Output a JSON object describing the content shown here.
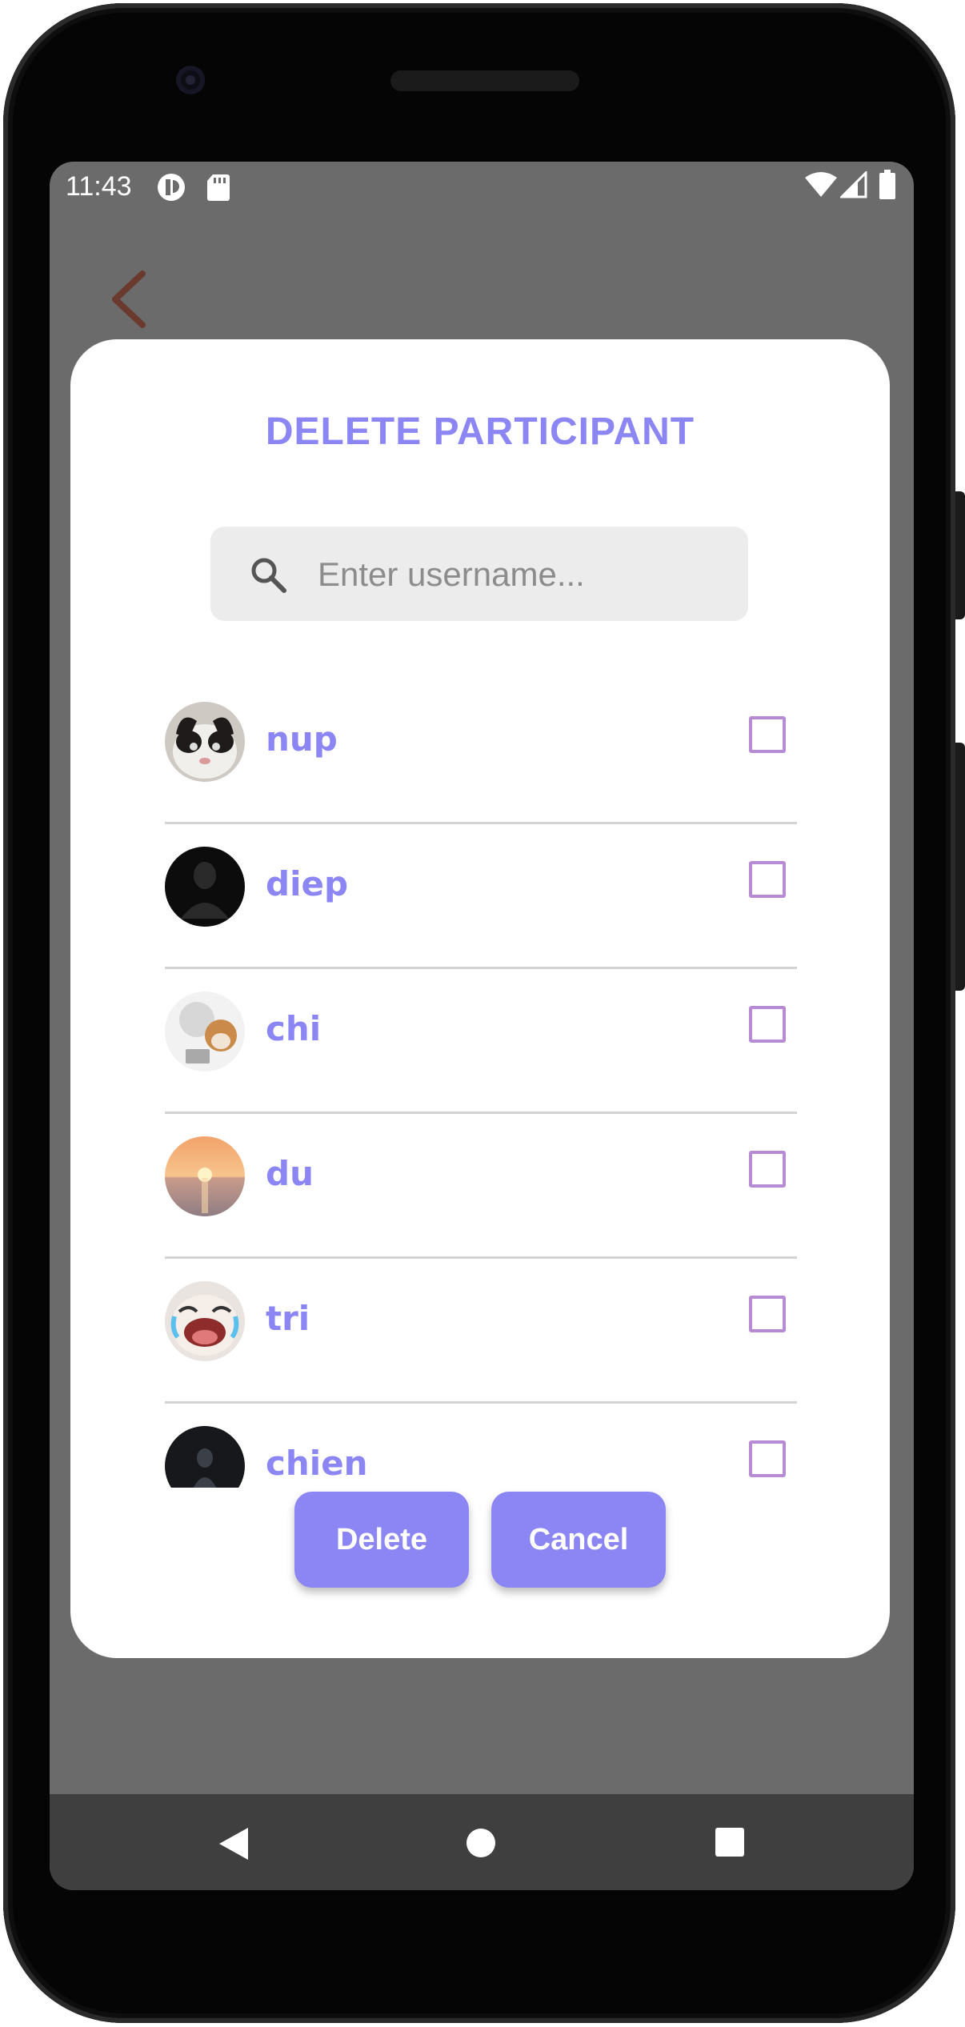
{
  "status_bar": {
    "time": "11:43"
  },
  "dialog": {
    "title": "DELETE PARTICIPANT",
    "search": {
      "placeholder": "Enter username...",
      "value": ""
    },
    "participants": [
      {
        "name": "nup",
        "checked": false
      },
      {
        "name": "diep",
        "checked": false
      },
      {
        "name": "chi",
        "checked": false
      },
      {
        "name": "du",
        "checked": false
      },
      {
        "name": "tri",
        "checked": false
      },
      {
        "name": "chien",
        "checked": false
      }
    ],
    "buttons": {
      "delete": "Delete",
      "cancel": "Cancel"
    }
  },
  "colors": {
    "accent": "#8b86f4",
    "checkbox_border": "#b78ad4",
    "back_arrow": "#6b3a2e",
    "scrim": "#6b6b6b"
  }
}
